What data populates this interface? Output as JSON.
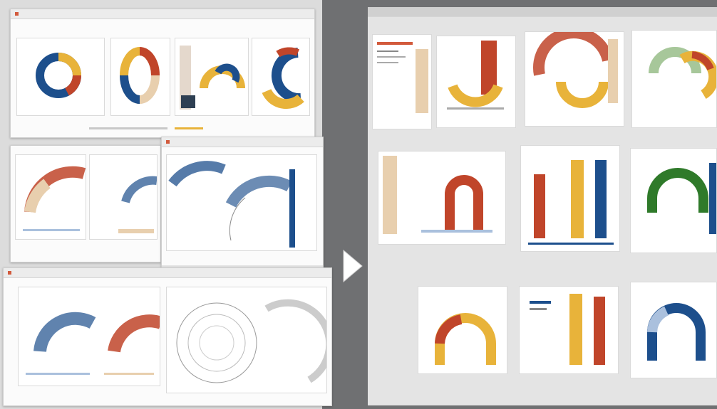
{
  "left_workspace": {
    "main_window_title": "",
    "window2_title": "",
    "window3_title": "",
    "window4_title": ""
  },
  "right_workspace": {
    "title": ""
  },
  "transition": {
    "icon": "arrow-right-icon"
  },
  "colors": {
    "navy": "#1d4f8c",
    "gold": "#e8b33a",
    "rust": "#c0452a",
    "sand": "#e8cfae",
    "green": "#2f7a2a",
    "teal": "#6aa7b8",
    "grey_bg": "#6f7072",
    "panel_bg": "#f4f4f4"
  }
}
